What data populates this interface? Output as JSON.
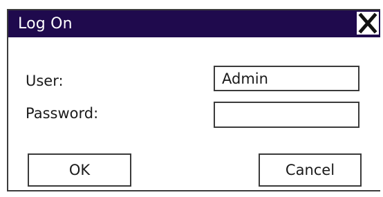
{
  "dialog": {
    "title": "Log On",
    "close_icon": "close-x-icon"
  },
  "form": {
    "user_label": "User:",
    "user_value": "Admin",
    "password_label": "Password:",
    "password_value": ""
  },
  "buttons": {
    "ok_label": "OK",
    "cancel_label": "Cancel"
  },
  "colors": {
    "titlebar": "#1f0a4d",
    "title_text": "#ffffff",
    "border": "#3a3a3a"
  }
}
